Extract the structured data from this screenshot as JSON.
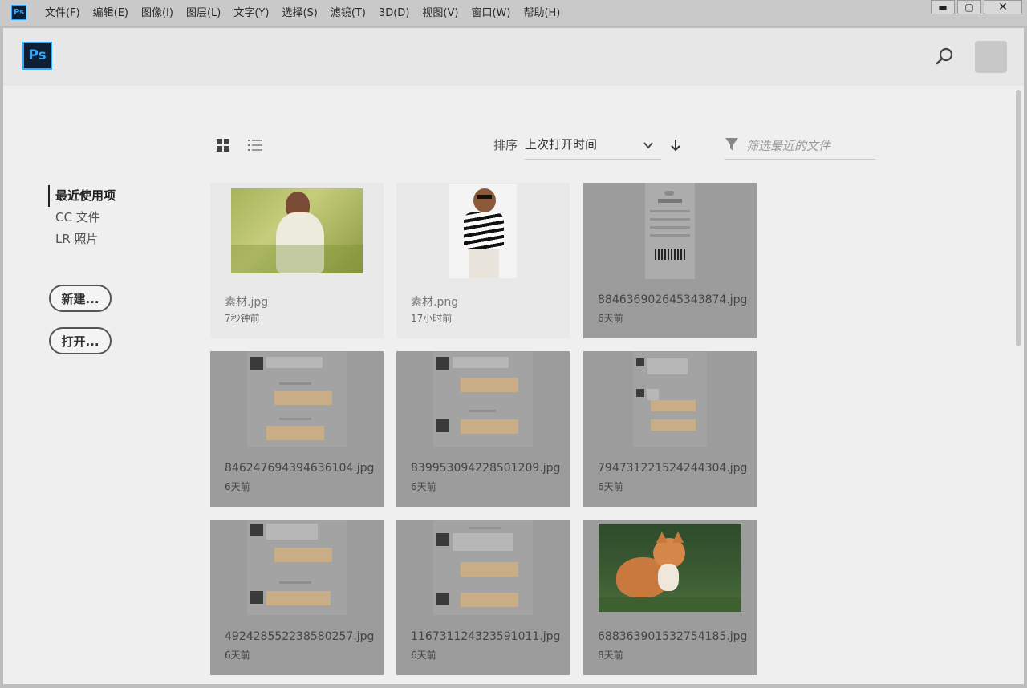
{
  "app": {
    "mini_logo": "Ps",
    "logo": "Ps"
  },
  "menu": [
    "文件(F)",
    "编辑(E)",
    "图像(I)",
    "图层(L)",
    "文字(Y)",
    "选择(S)",
    "滤镜(T)",
    "3D(D)",
    "视图(V)",
    "窗口(W)",
    "帮助(H)"
  ],
  "window_controls": {
    "minimize": "▬",
    "maximize": "▢",
    "close": "✕"
  },
  "sidebar": {
    "items": [
      {
        "label": "最近使用项",
        "active": true
      },
      {
        "label": "CC 文件",
        "active": false
      },
      {
        "label": "LR 照片",
        "active": false
      }
    ],
    "new_label": "新建...",
    "open_label": "打开..."
  },
  "toolbar": {
    "sort_label": "排序",
    "sort_value": "上次打开时间",
    "filter_placeholder": "筛选最近的文件"
  },
  "files": [
    {
      "name": "素材.jpg",
      "time": "7秒钟前",
      "thumb": "photo-girl-green"
    },
    {
      "name": "素材.png",
      "time": "17小时前",
      "thumb": "photo-girl-striped"
    },
    {
      "name": "884636902645343874.jpg",
      "time": "6天前",
      "thumb": "receipt-screenshot"
    },
    {
      "name": "846247694394636104.jpg",
      "time": "6天前",
      "thumb": "chat-screenshot"
    },
    {
      "name": "839953094228501209.jpg",
      "time": "6天前",
      "thumb": "chat-screenshot"
    },
    {
      "name": "794731221524244304.jpg",
      "time": "6天前",
      "thumb": "chat-screenshot"
    },
    {
      "name": "492428552238580257.jpg",
      "time": "6天前",
      "thumb": "chat-screenshot"
    },
    {
      "name": "116731124323591011.jpg",
      "time": "6天前",
      "thumb": "chat-screenshot"
    },
    {
      "name": "688363901532754185.jpg",
      "time": "8天前",
      "thumb": "photo-kitten"
    }
  ],
  "colors": {
    "accent": "#31a8ff",
    "logo_bg": "#0e1f33",
    "card_dim": "#9c9c9c",
    "card_light": "#e9e9e9"
  },
  "icons": [
    "search-icon",
    "grid-view-icon",
    "list-view-icon",
    "chevron-down-icon",
    "sort-arrow-down-icon",
    "filter-icon"
  ]
}
